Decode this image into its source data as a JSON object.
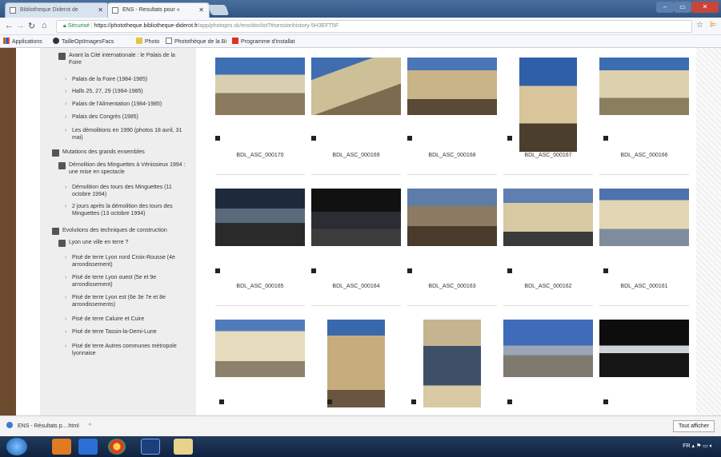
{
  "browser": {
    "tabs": [
      {
        "label": "Bibliotheque Diderot de",
        "active": false
      },
      {
        "label": "ENS - Resultats pour «",
        "active": true
      }
    ],
    "url_secure": "Sécurisé",
    "url_host": "https://phototheque.bibliotheque-diderot.fr",
    "url_path": "/app/photopro.sk/ens/doclist?#sessionhistory-5H3EFT5F",
    "bookmarks": [
      "Applications",
      "TailleOptImagesFacs",
      "Photo",
      "Photothèque de la Bi",
      "Programme d'installat"
    ]
  },
  "sidebar": {
    "items": [
      {
        "text": "Avant la Cité internationale : le Palais de la Foire",
        "kind": "box"
      },
      {
        "text": "Palais de la Foire (1984-1985)",
        "kind": "leaf"
      },
      {
        "text": "Halls 25, 27, 29 (1984-1985)",
        "kind": "leaf"
      },
      {
        "text": "Palais de l'Alimentation (1984-1985)",
        "kind": "leaf"
      },
      {
        "text": "Palais des Congrès (1985)",
        "kind": "leaf"
      },
      {
        "text": "Les démolitions en 1990 (photos 18 avril, 31 mai)",
        "kind": "leaf"
      },
      {
        "text": "Mutations des grands ensembles",
        "kind": "box"
      },
      {
        "text": "Démolition des Minguettes à Vénissieux 1994 : une mise en spectacle",
        "kind": "box"
      },
      {
        "text": "Démolition des tours des Minguettes (11 octobre 1994)",
        "kind": "leaf"
      },
      {
        "text": "2 jours après la démolition des tours des Minguettes (13 octobre 1994)",
        "kind": "leaf"
      },
      {
        "text": "Evolutions des techniques de construction",
        "kind": "box"
      },
      {
        "text": "Lyon une ville en terre ?",
        "kind": "box"
      },
      {
        "text": "Pisé de terre Lyon nord Croix-Rousse (4e arrondissement)",
        "kind": "leaf"
      },
      {
        "text": "Pisé de terre Lyon ouest (5e et 9e arrondissement)",
        "kind": "leaf"
      },
      {
        "text": "Pisé de terre Lyon est (6e 3e 7e et 8e arrondissements)",
        "kind": "leaf"
      },
      {
        "text": "Pisé de terre Caluire et Cuire",
        "kind": "leaf"
      },
      {
        "text": "Pisé de terre Tassin-la-Demi-Lune",
        "kind": "leaf"
      },
      {
        "text": "Pisé de terre Autres communes métropole lyonnaise",
        "kind": "leaf"
      }
    ]
  },
  "grid": {
    "row1": [
      "BDL_ASC_000170",
      "BDL_ASC_000169",
      "BDL_ASC_000168",
      "BDL_ASC_000167",
      "BDL_ASC_000166"
    ],
    "row2": [
      "BDL_ASC_000165",
      "BDL_ASC_000164",
      "BDL_ASC_000163",
      "BDL_ASC_000162",
      "BDL_ASC_000161"
    ]
  },
  "download": {
    "item": "ENS - Résultats p....html",
    "show_all": "Tout afficher"
  },
  "colors": {
    "tabbar": "#2e5584",
    "sidebar_bg": "#eeeeee",
    "secure_green": "#1a8a3a"
  }
}
